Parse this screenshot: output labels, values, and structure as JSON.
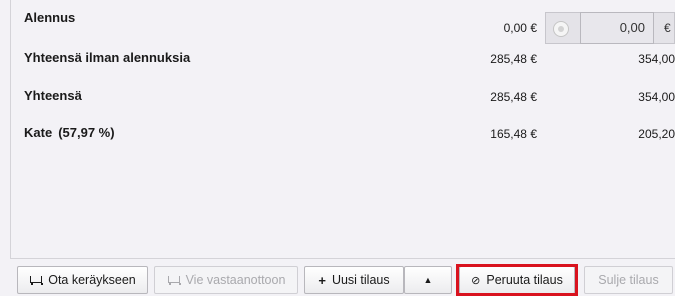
{
  "summary": {
    "discount": {
      "label": "Alennus",
      "value1": "0,00 €",
      "input_value": "0,00",
      "unit": "€"
    },
    "subtotal": {
      "label": "Yhteensä ilman alennuksia",
      "value1": "285,48 €",
      "value2": "354,00"
    },
    "total": {
      "label": "Yhteensä",
      "value1": "285,48 €",
      "value2": "354,00"
    },
    "margin": {
      "label": "Kate",
      "percent": "(57,97 %)",
      "value1": "165,48 €",
      "value2": "205,20"
    }
  },
  "footer": {
    "pick_label": "Ota keräykseen",
    "receive_label": "Vie vastaanottoon",
    "new_order_label": "Uusi tilaus",
    "cancel_label": "Peruuta tilaus",
    "close_label": "Sulje tilaus"
  },
  "icons": {
    "plus": "+",
    "caret": "▲",
    "cancel": "⊘"
  },
  "colors": {
    "highlight": "#d9121e"
  }
}
